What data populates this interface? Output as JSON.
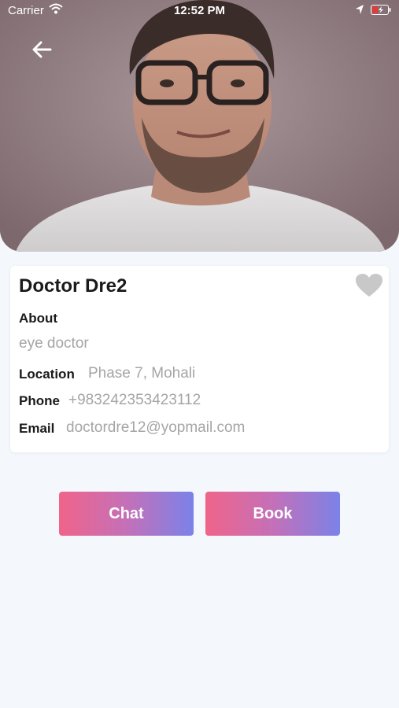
{
  "status_bar": {
    "carrier": "Carrier",
    "time": "12:52 PM"
  },
  "profile": {
    "name": "Doctor Dre2",
    "about_label": "About",
    "about_value": "eye doctor",
    "location_label": "Location",
    "location_value": "Phase 7, Mohali",
    "phone_label": "Phone",
    "phone_value": "+983242353423112",
    "email_label": "Email",
    "email_value": "doctordre12@yopmail.com",
    "favorite_icon": "heart-icon"
  },
  "actions": {
    "chat_label": "Chat",
    "book_label": "Book"
  },
  "colors": {
    "gradient_start": "#f0648a",
    "gradient_end": "#7b82e8",
    "background": "#f4f7fb"
  }
}
